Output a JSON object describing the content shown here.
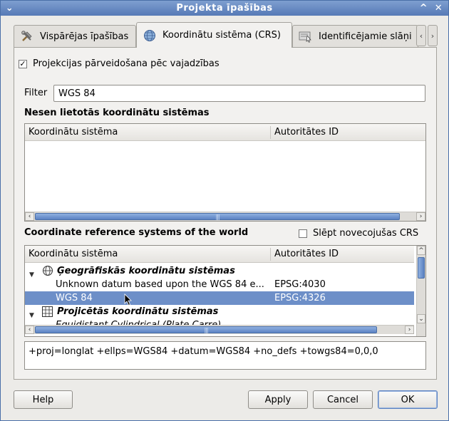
{
  "window": {
    "title": "Projekta īpašības"
  },
  "tabs": [
    {
      "label": "Vispārējas īpašības",
      "icon": "tools-icon"
    },
    {
      "label": "Koordinātu sistēma (CRS)",
      "icon": "globe-icon",
      "active": true
    },
    {
      "label": "Identificējamie slāņi",
      "icon": "identify-icon"
    }
  ],
  "crs_tab": {
    "transform_checkbox_label": "Projekcijas pārveidošana pēc vajadzības",
    "transform_checked": true,
    "filter_label": "Filter",
    "filter_value": "WGS 84",
    "recent_title": "Nesen lietotās koordinātu sistēmas",
    "recent_columns": [
      "Koordinātu sistēma",
      "Autoritātes ID"
    ],
    "world_title": "Coordinate reference systems of the world",
    "hide_deprecated_label": "Slēpt novecojušas CRS",
    "hide_deprecated_checked": false,
    "world_columns": [
      "Koordinātu sistēma",
      "Autoritātes ID"
    ],
    "world_rows": [
      {
        "type": "group",
        "label": "Ģeogrāfiskās koordinātu sistēmas",
        "icon": "globe-icon"
      },
      {
        "type": "item",
        "label": "Unknown datum based upon the WGS 84 e...",
        "id": "EPSG:4030"
      },
      {
        "type": "item",
        "label": "WGS 84",
        "id": "EPSG:4326",
        "selected": true
      },
      {
        "type": "group",
        "label": "Projicētās koordinātu sistēmas",
        "icon": "grid-icon"
      },
      {
        "type": "item",
        "label": "Equidistant Cylindrical (Plate Carre)",
        "id": ""
      }
    ],
    "proj_string": "+proj=longlat +ellps=WGS84 +datum=WGS84 +no_defs +towgs84=0,0,0"
  },
  "buttons": {
    "help": "Help",
    "apply": "Apply",
    "cancel": "Cancel",
    "ok": "OK"
  },
  "colors": {
    "selection": "#6d8fc8",
    "titlebar": "#6b8cc5"
  }
}
